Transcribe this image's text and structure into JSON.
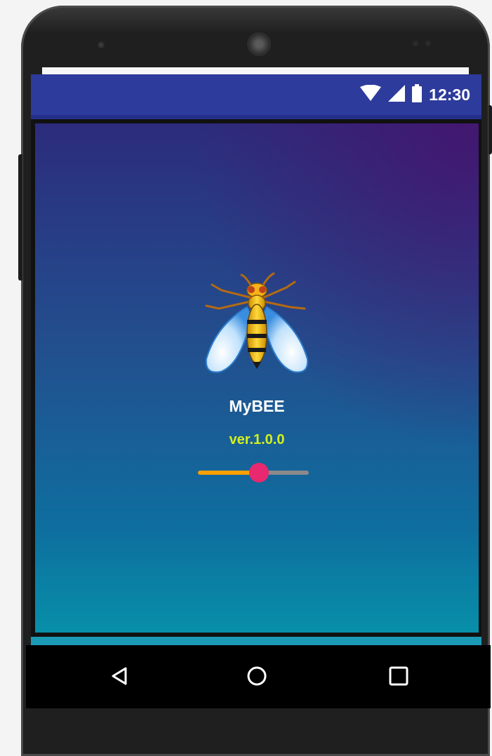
{
  "status_bar": {
    "time": "12:30",
    "icons": [
      "wifi-icon",
      "signal-icon",
      "battery-icon"
    ]
  },
  "app": {
    "name": "MyBEE",
    "version": "ver.1.0.0",
    "icon": "bee-icon"
  },
  "progress": {
    "value": 0.55
  },
  "nav_bar": {
    "icons": [
      "back-icon",
      "home-icon",
      "recents-icon"
    ]
  },
  "colors": {
    "status_bar": "#2d3b9c",
    "app_name": "#ffffff",
    "version": "#d4f01e",
    "slider_active": "#ffa000",
    "slider_inactive": "#8a8a8a",
    "slider_thumb": "#e8286f"
  }
}
